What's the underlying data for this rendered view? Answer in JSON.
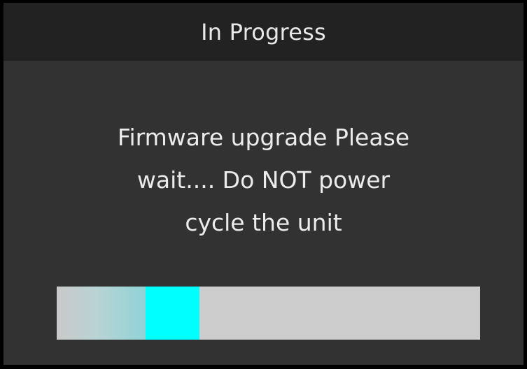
{
  "dialog": {
    "title": "In Progress",
    "message_lines": [
      "Firmware upgrade Please",
      "wait.... Do NOT power",
      "cycle the unit"
    ]
  },
  "progress": {
    "style": "indeterminate",
    "highlight_start_fraction": 0.21,
    "highlight_end_fraction": 0.338,
    "highlight_color": "#00ffff",
    "track_color": "#cccccc"
  },
  "colors": {
    "outer_frame": "#000000",
    "screen_background": "#323232",
    "title_bar_background": "#222222",
    "text": "#ececec"
  }
}
